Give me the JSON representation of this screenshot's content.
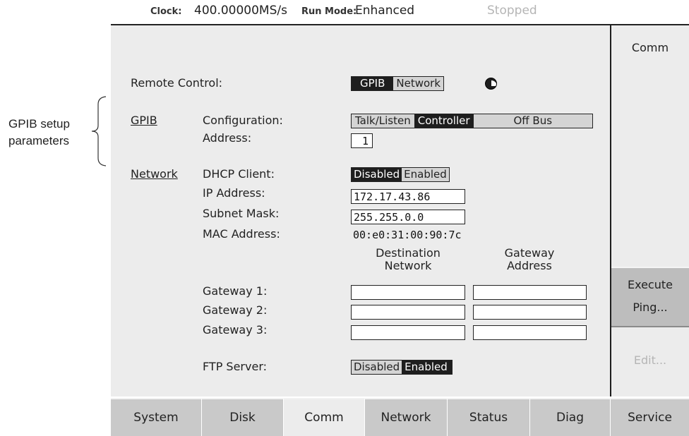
{
  "annotation": {
    "line1": "GPIB setup",
    "line2": "parameters"
  },
  "status_bar": {
    "clock_label": "Clock:",
    "clock_value": "400.00000MS/s",
    "run_mode_label": "Run Mode:",
    "run_mode_value": "Enhanced",
    "state": "Stopped"
  },
  "remote_control": {
    "label": "Remote Control:",
    "options": [
      "GPIB",
      "Network"
    ],
    "selected": "GPIB"
  },
  "gpib": {
    "section_label": "GPIB",
    "configuration_label": "Configuration:",
    "configuration_options": [
      "Talk/Listen",
      "Controller",
      "Off Bus"
    ],
    "configuration_selected": "Controller",
    "address_label": "Address:",
    "address_value": "1"
  },
  "network": {
    "section_label": "Network",
    "dhcp_label": "DHCP Client:",
    "dhcp_options": [
      "Disabled",
      "Enabled"
    ],
    "dhcp_selected": "Disabled",
    "ip_label": "IP Address:",
    "ip_value": "172.17.43.86",
    "subnet_label": "Subnet Mask:",
    "subnet_value": "255.255.0.0",
    "mac_label": "MAC Address:",
    "mac_value": "00:e0:31:00:90:7c",
    "dest_header_line1": "Destination",
    "dest_header_line2": "Network",
    "gw_header_line1": "Gateway",
    "gw_header_line2": "Address",
    "gateways": [
      {
        "label": "Gateway 1:",
        "destination": "",
        "address": ""
      },
      {
        "label": "Gateway 2:",
        "destination": "",
        "address": ""
      },
      {
        "label": "Gateway 3:",
        "destination": "",
        "address": ""
      }
    ],
    "ftp_label": "FTP Server:",
    "ftp_options": [
      "Disabled",
      "Enabled"
    ],
    "ftp_selected": "Enabled"
  },
  "side_menu": {
    "title": "Comm",
    "execute_ping_line1": "Execute",
    "execute_ping_line2": "Ping...",
    "edit": "Edit..."
  },
  "bottom_tabs": [
    "System",
    "Disk",
    "Comm",
    "Network",
    "Status",
    "Diag",
    "Service"
  ],
  "active_tab": "Comm"
}
